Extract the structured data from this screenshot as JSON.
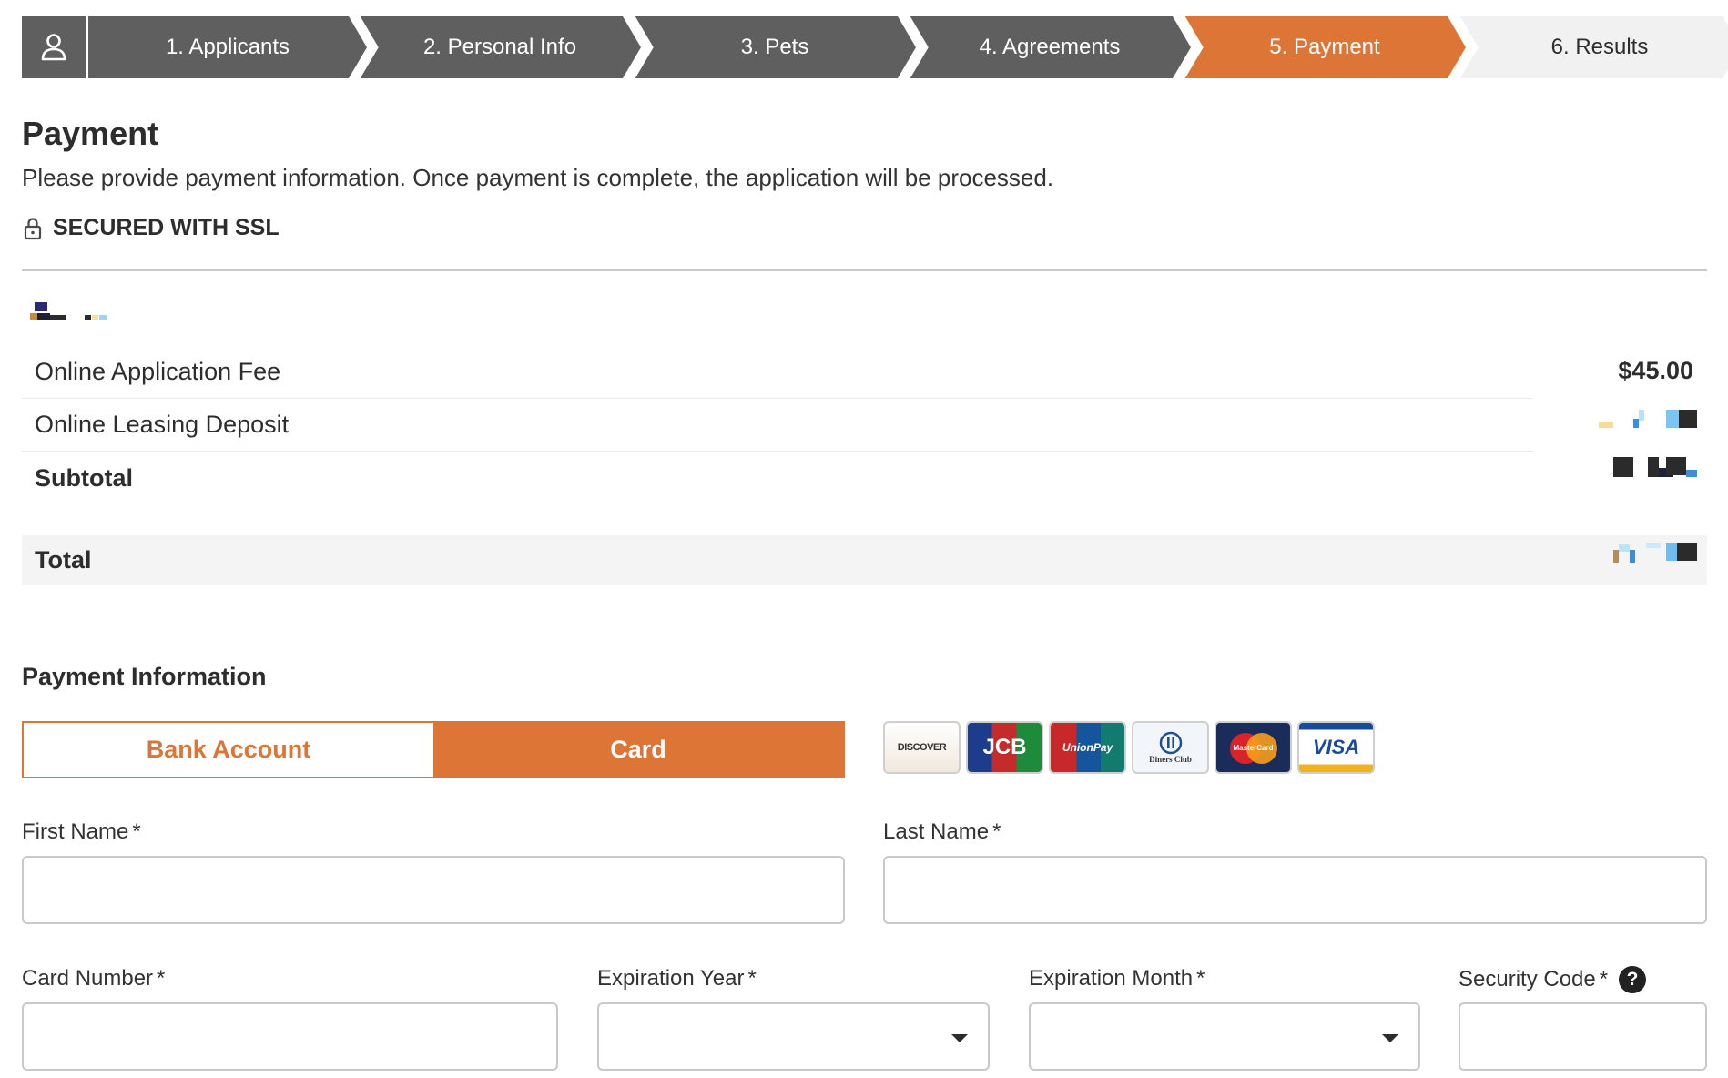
{
  "steps": [
    {
      "label": "1. Applicants",
      "state": "done"
    },
    {
      "label": "2. Personal Info",
      "state": "done"
    },
    {
      "label": "3. Pets",
      "state": "done"
    },
    {
      "label": "4. Agreements",
      "state": "done"
    },
    {
      "label": "5. Payment",
      "state": "active"
    },
    {
      "label": "6. Results",
      "state": "upcoming"
    }
  ],
  "colors": {
    "done": "#5f5f5f",
    "active": "#dc7535",
    "upcoming": "#f1f1f1",
    "accent": "#dc7535"
  },
  "page": {
    "title": "Payment",
    "intro": "Please provide payment information. Once payment is complete, the application will be processed.",
    "ssl_label": "SECURED WITH SSL"
  },
  "fees": {
    "application_fee": {
      "label": "Online Application Fee",
      "amount": "$45.00"
    },
    "leasing_deposit": {
      "label": "Online Leasing Deposit"
    },
    "subtotal": {
      "label": "Subtotal"
    },
    "total": {
      "label": "Total"
    }
  },
  "payment_info": {
    "title": "Payment Information",
    "methods": {
      "bank": "Bank Account",
      "card": "Card",
      "selected": "Card"
    },
    "card_brands": [
      "DISCOVER",
      "JCB",
      "UnionPay",
      "Diners Club",
      "MasterCard",
      "VISA"
    ]
  },
  "form": {
    "first_name": {
      "label": "First Name",
      "value": ""
    },
    "last_name": {
      "label": "Last Name",
      "value": ""
    },
    "card_number": {
      "label": "Card Number",
      "value": ""
    },
    "exp_year": {
      "label": "Expiration Year",
      "value": ""
    },
    "exp_month": {
      "label": "Expiration Month",
      "value": ""
    },
    "security_code": {
      "label": "Security Code",
      "value": ""
    },
    "required_mark": "*",
    "help_glyph": "?"
  }
}
